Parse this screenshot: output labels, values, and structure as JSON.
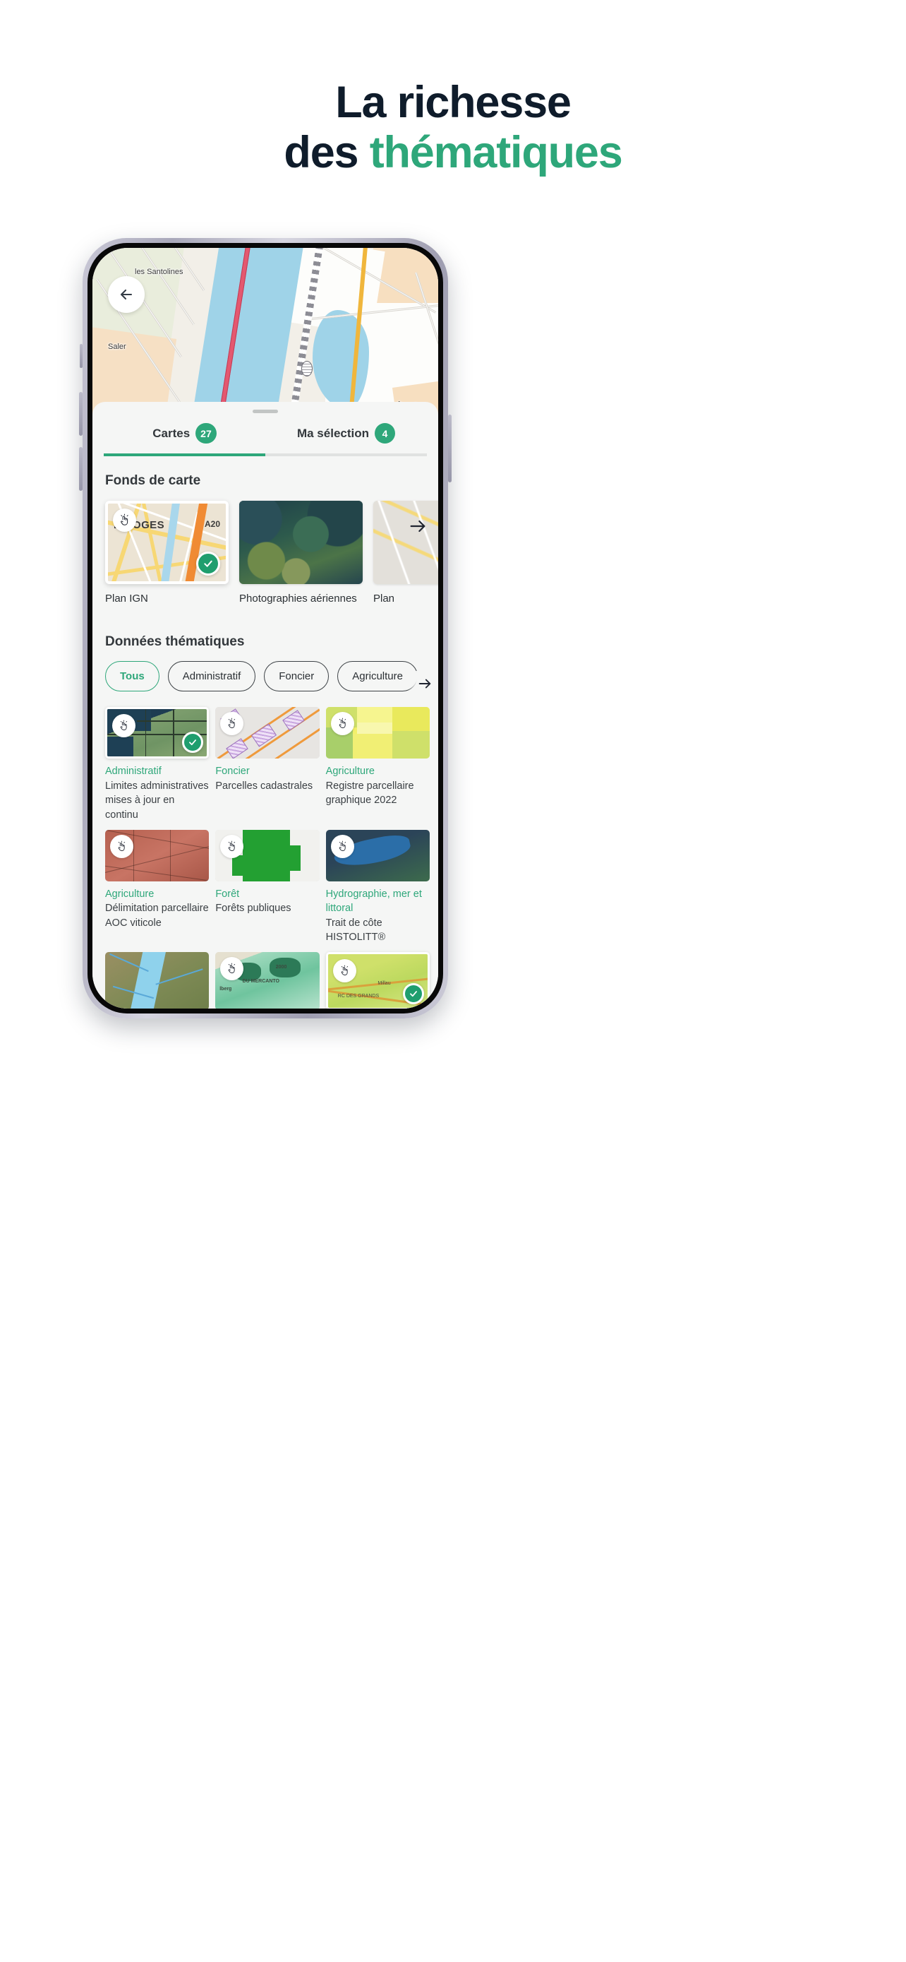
{
  "heading": {
    "line1": "La richesse",
    "line2_prefix": "des ",
    "line2_accent": "thématiques"
  },
  "colors": {
    "accent_green": "#2ea77a",
    "check_green": "#1f9e6e",
    "heading_dark": "#0f1c2b",
    "text_dark": "#33383c",
    "sheet_bg": "#f5f6f5"
  },
  "map": {
    "back_button": "back-arrow",
    "labels": [
      "les Santolines",
      "Saler",
      "les Îles d"
    ]
  },
  "sheet": {
    "tabs": [
      {
        "label": "Cartes",
        "badge": "27",
        "active": true
      },
      {
        "label": "Ma sélection",
        "badge": "4",
        "active": false
      }
    ],
    "basemap_section": {
      "title": "Fonds de carte",
      "cards": [
        {
          "label": "Plan IGN",
          "selected": true,
          "thumb_text_name": "LIMOGES",
          "thumb_text_road": "A20"
        },
        {
          "label": "Photographies aériennes",
          "selected": false
        },
        {
          "label": "Plan",
          "selected": false
        }
      ],
      "next_arrow": "arrow-right-icon"
    },
    "thematic_section": {
      "title": "Données thématiques",
      "chips": [
        {
          "label": "Tous",
          "active": true
        },
        {
          "label": "Administratif",
          "active": false
        },
        {
          "label": "Foncier",
          "active": false
        },
        {
          "label": "Agriculture",
          "active": false
        }
      ],
      "chips_next_arrow": "arrow-right-icon",
      "cards": [
        {
          "category": "Administratif",
          "description": "Limites administratives mises à jour en continu",
          "selected": true
        },
        {
          "category": "Foncier",
          "description": "Parcelles cadastrales",
          "selected": false
        },
        {
          "category": "Agriculture",
          "description": "Registre parcellaire graphique 2022",
          "selected": false
        },
        {
          "category": "Agriculture",
          "description": "Délimitation parcellaire AOC viticole",
          "selected": false
        },
        {
          "category": "Forêt",
          "description": "Forêts publiques",
          "selected": false
        },
        {
          "category": "Hydrographie, mer et littoral",
          "description": "Trait de côte HISTOLITT®",
          "selected": false
        },
        {
          "category": "",
          "description": "",
          "selected": false
        },
        {
          "category": "",
          "description": "",
          "selected": false
        },
        {
          "category": "",
          "description": "",
          "selected": true
        }
      ]
    }
  }
}
